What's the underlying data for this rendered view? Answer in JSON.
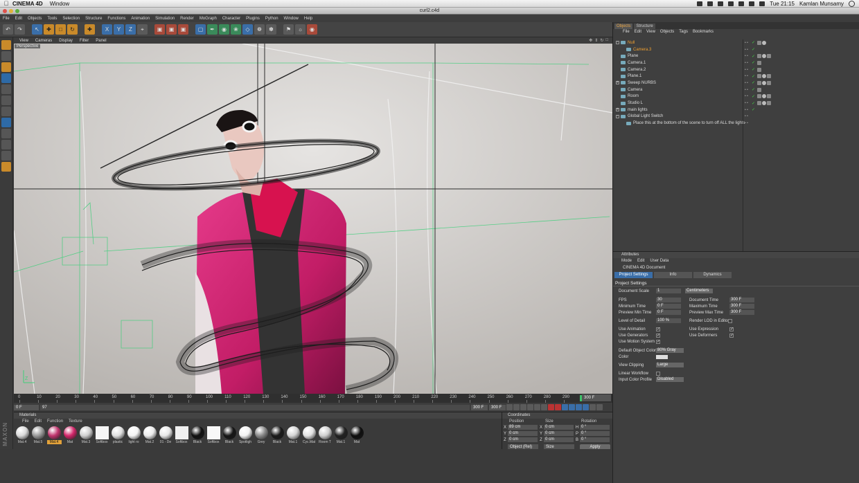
{
  "mac": {
    "app_name": "CINEMA 4D",
    "menu": [
      "Window"
    ],
    "time": "Tue 21:15",
    "user": "Kamlan Munsamy"
  },
  "window": {
    "title": "curl2.c4d"
  },
  "main_menu": [
    "File",
    "Edit",
    "Objects",
    "Tools",
    "Selection",
    "Structure",
    "Functions",
    "Animation",
    "Simulation",
    "Render",
    "MoGraph",
    "Character",
    "Plugins",
    "Python",
    "Window",
    "Help"
  ],
  "viewport": {
    "menu": [
      "View",
      "Cameras",
      "Display",
      "Filter",
      "Panel"
    ],
    "label": "Perspective"
  },
  "timeline": {
    "ticks": [
      "0",
      "10",
      "20",
      "30",
      "40",
      "50",
      "60",
      "70",
      "80",
      "90",
      "100",
      "110",
      "120",
      "130",
      "140",
      "150",
      "160",
      "170",
      "180",
      "190",
      "200",
      "210",
      "220",
      "230",
      "240",
      "250",
      "260",
      "270",
      "280",
      "290"
    ],
    "end_frame": "300 F",
    "current": "0 F",
    "min_frame": "0 F",
    "max_frame": "300 F",
    "preview_max": "300 F",
    "playhead_label": "97"
  },
  "materials": {
    "title": "Materials",
    "menu": [
      "File",
      "Edit",
      "Function",
      "Texture"
    ],
    "items": [
      {
        "name": "Mat.4",
        "color": "#d9d9d9"
      },
      {
        "name": "Mat.5",
        "color": "#9a9a9a"
      },
      {
        "name": "Mat.4",
        "color": "#c0356e",
        "selected": true
      },
      {
        "name": "Mat",
        "color": "#d2266a"
      },
      {
        "name": "Mat.3",
        "color": "#cfcfcf"
      },
      {
        "name": "Softbox",
        "color": "#f6f6f6",
        "square": true
      },
      {
        "name": "plastic",
        "color": "#e0e0e0"
      },
      {
        "name": "light ro",
        "color": "#f4f4f4"
      },
      {
        "name": "Mat.2",
        "color": "#ececec"
      },
      {
        "name": "01 - De",
        "color": "#e8e8e8"
      },
      {
        "name": "Softbox",
        "color": "#f0f0f0",
        "square": true
      },
      {
        "name": "Black",
        "color": "#111111"
      },
      {
        "name": "Softbox",
        "color": "#f8f8f8",
        "square": true
      },
      {
        "name": "Black",
        "color": "#161616"
      },
      {
        "name": "Spotligh",
        "color": "#f2f2f2"
      },
      {
        "name": "Grey",
        "color": "#8a8a8a"
      },
      {
        "name": "Black",
        "color": "#1a1a1a"
      },
      {
        "name": "Mat.1",
        "color": "#d4d4d4"
      },
      {
        "name": "Cyc.Mat",
        "color": "#e2e2e2"
      },
      {
        "name": "Room T",
        "color": "#cfcfcf"
      },
      {
        "name": "Mat.1",
        "color": "#222222"
      },
      {
        "name": "Mat",
        "color": "#0e0e0e"
      }
    ]
  },
  "coordinates": {
    "title": "Coordinates",
    "headers": [
      "Position",
      "Size",
      "Rotation"
    ],
    "rows": [
      {
        "axis": "X",
        "pos": "89 cm",
        "size_axis": "X",
        "size": "0 cm",
        "rot_axis": "H",
        "rot": "0 °"
      },
      {
        "axis": "Y",
        "pos": "0 cm",
        "size_axis": "Y",
        "size": "0 cm",
        "rot_axis": "P",
        "rot": "0 °"
      },
      {
        "axis": "Z",
        "pos": "0 cm",
        "size_axis": "Z",
        "size": "0 cm",
        "rot_axis": "B",
        "rot": "0 °"
      }
    ],
    "mode": "Object (Rel)",
    "size_mode": "Size",
    "apply": "Apply"
  },
  "object_manager": {
    "tabs": [
      "Objects",
      "Structure"
    ],
    "menu": [
      "File",
      "Edit",
      "View",
      "Objects",
      "Tags",
      "Bookmarks"
    ],
    "objects": [
      {
        "name": "Null",
        "highlight": true,
        "expander": "-"
      },
      {
        "name": "Camera.3",
        "highlight": true,
        "indent": 1
      },
      {
        "name": "Plane"
      },
      {
        "name": "Camera.1"
      },
      {
        "name": "Camera.2"
      },
      {
        "name": "Plane.1"
      },
      {
        "name": "Sweep NURBS",
        "expander": "+"
      },
      {
        "name": "Camera"
      },
      {
        "name": "Room"
      },
      {
        "name": "Studio L"
      },
      {
        "name": "main lights",
        "expander": "+"
      },
      {
        "name": "Global Light Switch",
        "expander": "-"
      },
      {
        "name": "Place this at the bottom of the scene to turn off ALL the lights",
        "indent": 1
      }
    ]
  },
  "attributes": {
    "title": "Attributes",
    "menu": [
      "Mode",
      "Edit",
      "User Data"
    ],
    "doc_title": "CINEMA 4D Document",
    "tabs": [
      "Project Settings",
      "Info",
      "Dynamics"
    ],
    "section": "Project Settings",
    "document_scale_label": "Document Scale",
    "document_scale": "1",
    "document_scale_unit": "Centimeters",
    "fps_label": "FPS",
    "fps": "30",
    "document_time_label": "Document Time",
    "document_time": "300 F",
    "min_time_label": "Minimum Time",
    "min_time": "0 F",
    "max_time_label": "Maximum Time",
    "max_time": "300 F",
    "prev_min_label": "Preview Min Time",
    "prev_min": "0 F",
    "prev_max_label": "Preview Max Time",
    "prev_max": "300 F",
    "lod_label": "Level of Detail",
    "lod": "100 %",
    "render_lod_label": "Render LOD in Editor",
    "use_animation_label": "Use Animation",
    "use_expression_label": "Use Expression",
    "use_generators_label": "Use Generators",
    "use_deformers_label": "Use Deformers",
    "use_motion_label": "Use Motion System",
    "default_color_label": "Default Object Color",
    "default_color": "80% Gray",
    "color_label": "Color",
    "view_clipping_label": "View Clipping",
    "view_clipping": "Large",
    "linear_workflow_label": "Linear Workflow",
    "input_profile_label": "Input Color Profile",
    "input_profile": "Disabled"
  },
  "left_tools_brand": "MAXON"
}
